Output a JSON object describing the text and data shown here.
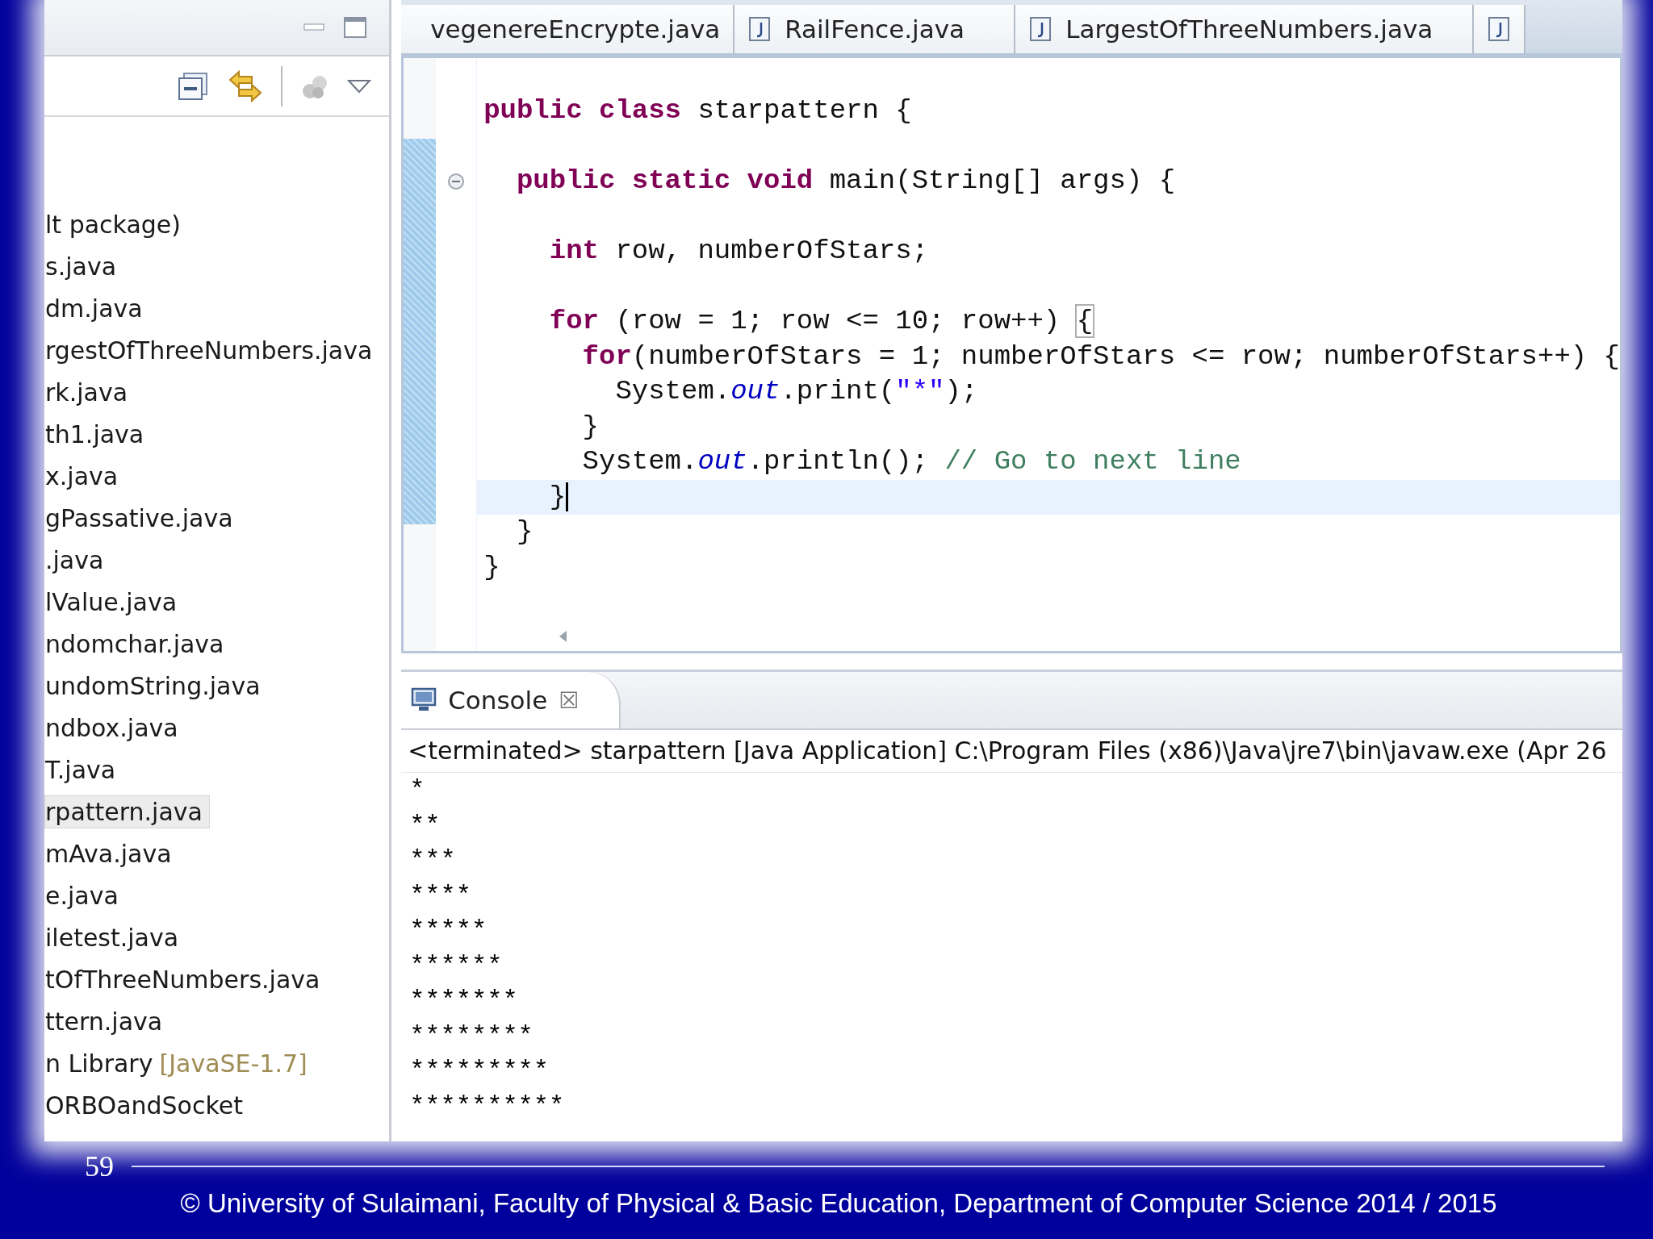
{
  "explorer": {
    "items": [
      {
        "label": "lt package)",
        "selected": false
      },
      {
        "label": "s.java",
        "selected": false
      },
      {
        "label": "dm.java",
        "selected": false
      },
      {
        "label": "rgestOfThreeNumbers.java",
        "selected": false
      },
      {
        "label": "rk.java",
        "selected": false
      },
      {
        "label": "th1.java",
        "selected": false
      },
      {
        "label": "x.java",
        "selected": false
      },
      {
        "label": "gPassative.java",
        "selected": false
      },
      {
        "label": ".java",
        "selected": false
      },
      {
        "label": "lValue.java",
        "selected": false
      },
      {
        "label": "ndomchar.java",
        "selected": false
      },
      {
        "label": "undomString.java",
        "selected": false
      },
      {
        "label": "ndbox.java",
        "selected": false
      },
      {
        "label": "T.java",
        "selected": false
      },
      {
        "label": "rpattern.java",
        "selected": true
      },
      {
        "label": "mAva.java",
        "selected": false
      },
      {
        "label": "e.java",
        "selected": false
      },
      {
        "label": "iletest.java",
        "selected": false
      },
      {
        "label": "tOfThreeNumbers.java",
        "selected": false
      },
      {
        "label": "ttern.java",
        "selected": false
      },
      {
        "label": "n Library",
        "decoration": "[JavaSE-1.7]",
        "selected": false
      },
      {
        "label": "ORBOandSocket",
        "selected": false
      }
    ]
  },
  "editor": {
    "tabs": [
      {
        "kind": "labeled",
        "label": "vegenereEncrypte.java"
      },
      {
        "kind": "labeled",
        "label": "RailFence.java"
      },
      {
        "kind": "labeled",
        "label": "LargestOfThreeNumbers.java"
      },
      {
        "kind": "icon"
      }
    ],
    "lines": [
      {
        "fold": false,
        "current": false,
        "tokens": [
          {
            "kind": "keyword",
            "text": "public class"
          },
          {
            "kind": "plain",
            "text": " starpattern {"
          }
        ]
      },
      {
        "fold": false,
        "current": false
      },
      {
        "fold": true,
        "current": false,
        "tokens": [
          {
            "kind": "keyword",
            "text": "  public static void"
          },
          {
            "kind": "plain",
            "text": " main(String[] args) {"
          }
        ]
      },
      {
        "fold": false,
        "current": false
      },
      {
        "fold": false,
        "current": false,
        "tokens": [
          {
            "kind": "keyword",
            "text": "    int"
          },
          {
            "kind": "plain",
            "text": " row, numberOfStars;"
          }
        ]
      },
      {
        "fold": false,
        "current": false
      },
      {
        "fold": false,
        "current": false,
        "tokens": [
          {
            "kind": "keyword",
            "text": "    for"
          },
          {
            "kind": "plain",
            "text": " (row = 1; row <= 10; row++) "
          },
          {
            "kind": "bracket",
            "text": "{"
          }
        ]
      },
      {
        "fold": false,
        "current": false,
        "tokens": [
          {
            "kind": "keyword",
            "text": "      for"
          },
          {
            "kind": "plain",
            "text": "(numberOfStars = 1; numberOfStars <= row; numberOfStars++) {"
          }
        ]
      },
      {
        "fold": false,
        "current": false,
        "tokens": [
          {
            "kind": "plain",
            "text": "        System."
          },
          {
            "kind": "field",
            "text": "out"
          },
          {
            "kind": "plain",
            "text": ".print("
          },
          {
            "kind": "string",
            "text": "\"*\""
          },
          {
            "kind": "plain",
            "text": ");"
          }
        ]
      },
      {
        "fold": false,
        "current": false,
        "tokens": [
          {
            "kind": "plain",
            "text": "      }"
          }
        ]
      },
      {
        "fold": false,
        "current": false,
        "tokens": [
          {
            "kind": "plain",
            "text": "      System."
          },
          {
            "kind": "field",
            "text": "out"
          },
          {
            "kind": "plain",
            "text": ".println(); "
          },
          {
            "kind": "comment",
            "text": "// Go to next line"
          }
        ]
      },
      {
        "fold": false,
        "current": true,
        "tokens": [
          {
            "kind": "plain",
            "text": "    }"
          }
        ]
      },
      {
        "fold": false,
        "current": false,
        "tokens": [
          {
            "kind": "plain",
            "text": "  }"
          }
        ]
      },
      {
        "fold": false,
        "current": false,
        "tokens": [
          {
            "kind": "plain",
            "text": "}"
          }
        ]
      }
    ]
  },
  "console": {
    "title": "Console",
    "close": "☒",
    "status": "<terminated> starpattern [Java Application] C:\\Program Files (x86)\\Java\\jre7\\bin\\javaw.exe (Apr 26",
    "output": [
      "*",
      "**",
      "***",
      "****",
      "*****",
      "******",
      "*******",
      "********",
      "*********",
      "**********"
    ]
  },
  "footer": {
    "slide_number": "59",
    "text": "© University of Sulaimani, Faculty of Physical & Basic Education, Department of Computer Science  2014 / 2015"
  }
}
